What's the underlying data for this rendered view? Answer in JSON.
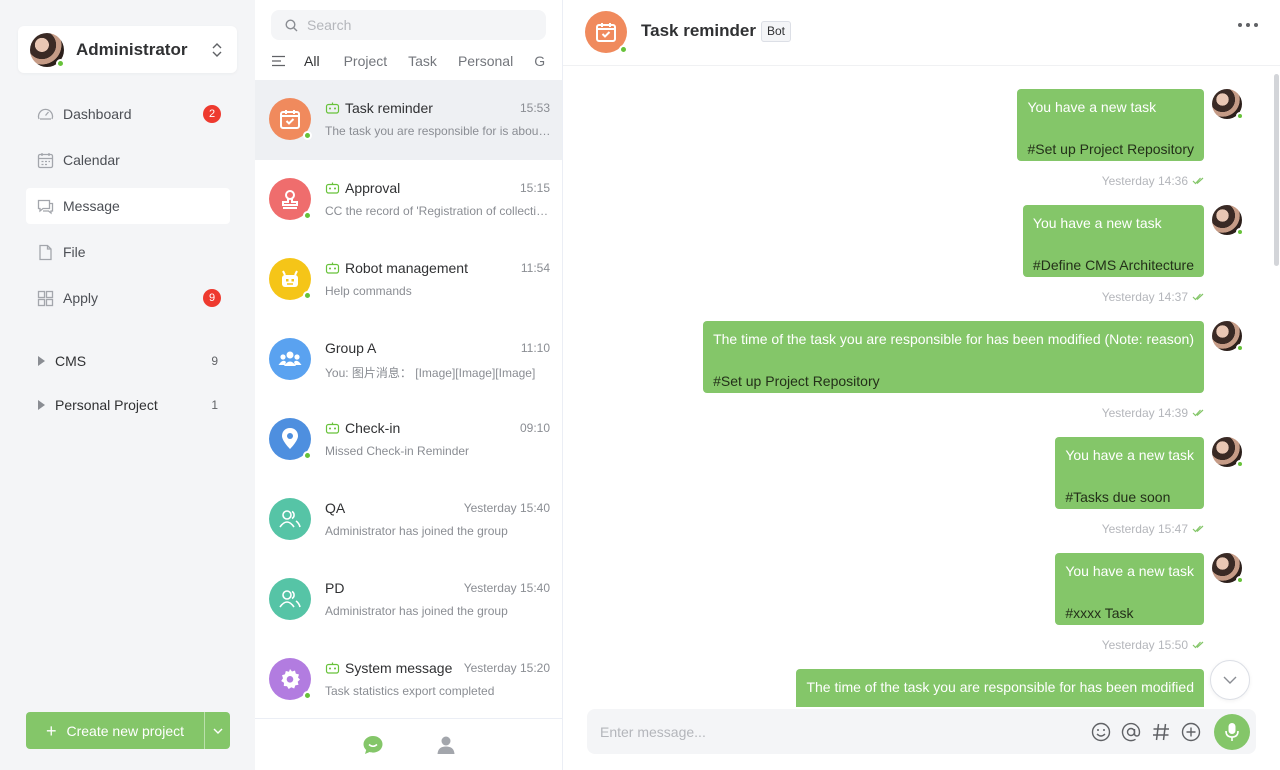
{
  "user": {
    "name": "Administrator"
  },
  "nav": [
    {
      "label": "Dashboard",
      "badge": "2",
      "icon": "dashboard-icon"
    },
    {
      "label": "Calendar",
      "badge": "",
      "icon": "calendar-icon"
    },
    {
      "label": "Message",
      "badge": "",
      "icon": "message-icon"
    },
    {
      "label": "File",
      "badge": "",
      "icon": "file-icon"
    },
    {
      "label": "Apply",
      "badge": "9",
      "icon": "apply-icon"
    }
  ],
  "projects": [
    {
      "label": "CMS",
      "count": "9"
    },
    {
      "label": "Personal Project",
      "count": "1"
    }
  ],
  "create_button": {
    "label": "Create new project"
  },
  "search": {
    "placeholder": "Search"
  },
  "filters": [
    "All",
    "Project",
    "Task",
    "Personal",
    "G"
  ],
  "conversations": [
    {
      "title": "Task reminder",
      "time": "15:53",
      "preview": "The task you are responsible for is about to expire",
      "bot": true,
      "color": "#f08a5d",
      "icon": "calendar-check-icon"
    },
    {
      "title": "Approval",
      "time": "15:15",
      "preview": "CC the record of 'Registration of collection'",
      "bot": true,
      "color": "#ef6d6d",
      "icon": "stamp-icon"
    },
    {
      "title": "Robot management",
      "time": "11:54",
      "preview": "Help commands",
      "bot": true,
      "color": "#f5c518",
      "icon": "robot-icon"
    },
    {
      "title": "Group A",
      "time": "11:10",
      "preview": "You: 图片消息：  [Image][Image][Image]",
      "bot": false,
      "color": "#5aa2f0",
      "icon": "group-icon"
    },
    {
      "title": "Check-in",
      "time": "09:10",
      "preview": "Missed Check-in Reminder",
      "bot": true,
      "color": "#4e8fdf",
      "icon": "location-pin-icon"
    },
    {
      "title": "QA",
      "time": "Yesterday 15:40",
      "preview": "Administrator has joined the group",
      "bot": false,
      "color": "#56c4a6",
      "icon": "group-icon"
    },
    {
      "title": "PD",
      "time": "Yesterday 15:40",
      "preview": "Administrator has joined the group",
      "bot": false,
      "color": "#56c4a6",
      "icon": "group-icon"
    },
    {
      "title": "System message",
      "time": "Yesterday 15:20",
      "preview": "Task statistics export completed",
      "bot": true,
      "color": "#b27ce0",
      "icon": "gear-icon"
    }
  ],
  "chat": {
    "title": "Task reminder",
    "tag": "Bot",
    "messages": [
      {
        "line1": "You have a new task",
        "line2": "#Set up Project Repository",
        "time": "Yesterday 14:36"
      },
      {
        "line1": "You have a new task",
        "line2": "#Define CMS Architecture",
        "time": "Yesterday 14:37"
      },
      {
        "line1": "The time of the task you are responsible for has been modified (Note: reason)",
        "line2": "#Set up Project Repository",
        "time": "Yesterday 14:39"
      },
      {
        "line1": "You have a new task",
        "line2": "#Tasks due soon",
        "time": "Yesterday 15:47"
      },
      {
        "line1": "You have a new task",
        "line2": "#xxxx Task",
        "time": "Yesterday 15:50"
      },
      {
        "line1": "The time of the task you are responsible for has been modified",
        "line2": "",
        "time": ""
      }
    ],
    "composer_placeholder": "Enter message..."
  },
  "colors": {
    "accent": "#84c669",
    "badge": "#ee3a2f",
    "online": "#67c23a"
  }
}
